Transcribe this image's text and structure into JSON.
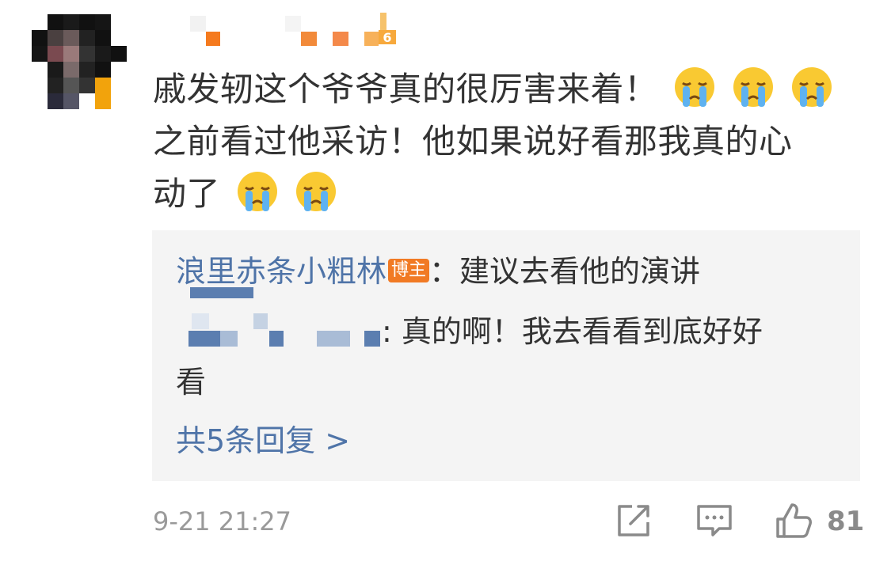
{
  "comment": {
    "line1": "戚发轫这个爷爷真的很厉害来着！",
    "line2": "之前看过他采访！他如果说好看那我真的心",
    "line3": "动了",
    "emoji_icon": "crying-face-emoji"
  },
  "replies": [
    {
      "user": "浪里赤条小粗林",
      "badge": "博主",
      "text": "：建议去看他的演讲"
    },
    {
      "user": "",
      "text": ": 真的啊！我去看看到底好好",
      "text_cont": "看"
    }
  ],
  "more_replies": "共5条回复 >",
  "footer": {
    "time": "9-21 21:27",
    "share_icon": "share-icon",
    "comment_icon": "comment-icon",
    "like_icon": "thumbs-up-icon",
    "like_count": "81"
  },
  "colors": {
    "link": "#4f74a8",
    "badge": "#f17a24",
    "reply_bg": "#f4f4f4",
    "meta": "#9a9a9a"
  }
}
